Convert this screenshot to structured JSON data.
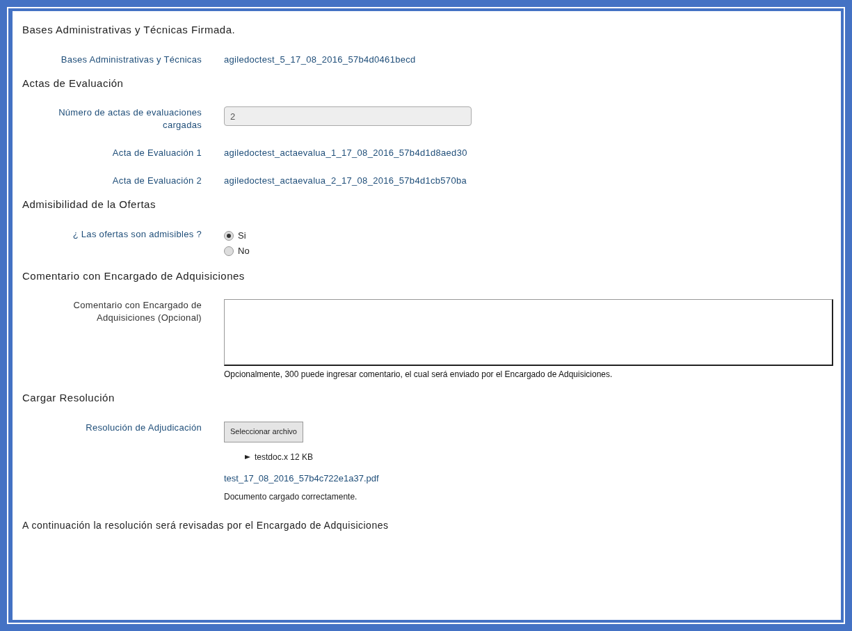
{
  "sections": [
    {
      "title": "Bases Administrativas y Técnicas Firmada.",
      "fields": [
        {
          "kind": "link",
          "label": "Bases Administrativas y Técnicas",
          "value": "agiledoctest_5_17_08_2016_57b4d0461becd"
        }
      ]
    },
    {
      "title": "Actas de Evaluación",
      "fields": [
        {
          "kind": "input",
          "label": "Número de actas de evaluaciones cargadas",
          "value": "2",
          "disabled": true
        },
        {
          "kind": "link",
          "label": "Acta de Evaluación 1",
          "value": "agiledoctest_actaevalua_1_17_08_2016_57b4d1d8aed30"
        },
        {
          "kind": "link",
          "label": "Acta de Evaluación 2",
          "value": "agiledoctest_actaevalua_2_17_08_2016_57b4d1cb570ba"
        }
      ]
    },
    {
      "title": "Admisibilidad de la Ofertas",
      "fields": [
        {
          "kind": "radio",
          "label": "¿ Las ofertas son admisibles ?",
          "options": [
            {
              "label": "Si",
              "selected": true
            },
            {
              "label": "No",
              "selected": false
            }
          ]
        }
      ]
    },
    {
      "title": "Comentario con Encargado de Adquisiciones",
      "fields": [
        {
          "kind": "textarea",
          "label": "Comentario con Encargado de Adquisiciones (Opcional)",
          "help": "Opcionalmente, 300 puede ingresar comentario, el cual será enviado por el Encargado de Adquisiciones."
        }
      ]
    },
    {
      "title": "Cargar Resolución",
      "fields": [
        {
          "kind": "file",
          "label": "Resolución de Adjudicación",
          "button": "Seleccionar archivo",
          "file": "testdoc.x 12 KB",
          "link": "test_17_08_2016_57b4c722e1a37.pdf",
          "note": "Documento cargado correctamente."
        }
      ]
    }
  ],
  "footer": "A continuación la resolución será revisadas por el Encargado de Adquisiciones"
}
